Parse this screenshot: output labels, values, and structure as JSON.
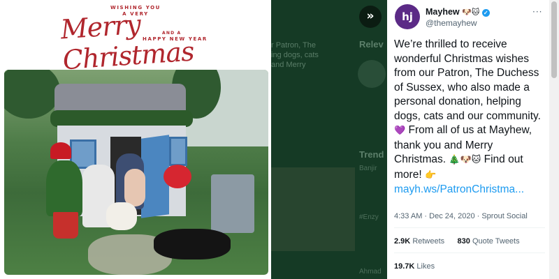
{
  "card": {
    "wishing": "WISHING YOU",
    "a_very": "A VERY",
    "script": "Merry Christmas",
    "and_a": "AND A",
    "new_year": "HAPPY NEW YEAR"
  },
  "background": {
    "snippet_line1": "r Patron, The",
    "snippet_line2": "ing dogs, cats",
    "snippet_line3": "and Merry",
    "relevant_label": "Relev",
    "trends_label": "Trend",
    "trend_1": "Banjir",
    "trend_2": "#Enzy",
    "trend_3": "Ahmad"
  },
  "toggle": {
    "icon": "double-chevron-right-icon",
    "glyph": "»"
  },
  "tweet": {
    "author_name": "Mayhew",
    "author_emoji": "🐶🐱",
    "handle": "@themayhew",
    "avatar_text": "hj",
    "body_1": "We’re thrilled to receive wonderful Christmas wishes from our Patron, The Duchess of Sussex, who also made a personal donation, helping dogs, cats and our community. ",
    "emoji_heart": "💜",
    "body_2": " From all of us at Mayhew, thank you and Merry Christmas. ",
    "emoji_trio": "🎄🐶🐱",
    "body_3": " Find out more! ",
    "emoji_point": "👉",
    "link": "mayh.ws/PatronChristma...",
    "time": "4:33 AM · Dec 24, 2020 · Sprout Social",
    "retweets_count": "2.9K",
    "retweets_label": "Retweets",
    "quotes_count": "830",
    "quotes_label": "Quote Tweets",
    "likes_count": "19.7K",
    "likes_label": "Likes",
    "more_icon": "···"
  },
  "colors": {
    "accent": "#1d9bf0",
    "card_red": "#b0262d",
    "overlay": "#11331f",
    "avatar_purple": "#5b2a86"
  }
}
